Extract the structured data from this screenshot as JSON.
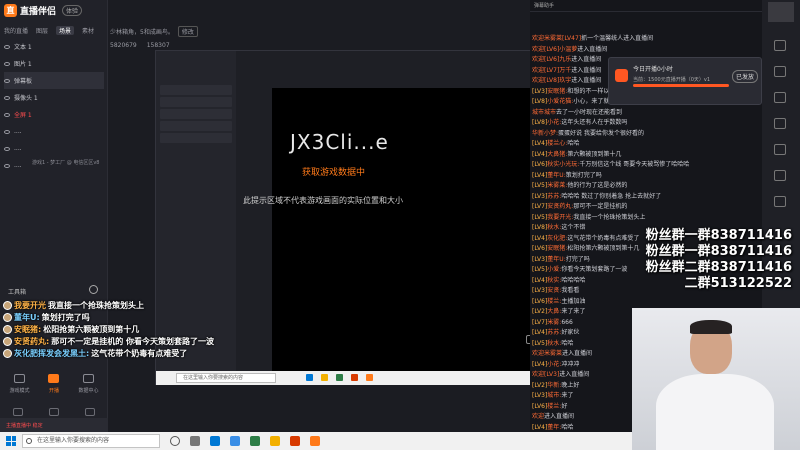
{
  "app": {
    "name": "直播伴侣",
    "tag": "体验",
    "tabs": [
      "我的直播",
      "图层",
      "场景",
      "素材"
    ]
  },
  "scenes": [
    {
      "label": "文本 1"
    },
    {
      "label": "图片 1"
    },
    {
      "label": "弹幕板"
    },
    {
      "label": "摄像头 1"
    },
    {
      "label": "全屏 1"
    },
    {
      "label": "...."
    },
    {
      "label": "...."
    },
    {
      "label": "...."
    }
  ],
  "left_note": "游戏1 - 梦工厂 @ 电信区区v8",
  "tools_label": "工具箱",
  "left_bottom": [
    {
      "label": "游戏模式"
    },
    {
      "label": "开播"
    },
    {
      "label": "数据中心"
    }
  ],
  "stream_info": {
    "title": "少林箱角，5和成画鸟。",
    "edit": "修改",
    "stats": [
      "5820679",
      "158307"
    ]
  },
  "game": {
    "title": "JX3Cli...e",
    "subtitle": "获取游戏数据中",
    "note": "此提示区域不代表游戏画面的实际位置和大小"
  },
  "danmaku": [
    {
      "name": "我要开光",
      "text": "我直接一个抢珠抢策划头上",
      "orange": true
    },
    {
      "name": "董年U:",
      "text": "策划打完了吗",
      "orange": false
    },
    {
      "name": "安眠猪:",
      "text": "松阳抢第六颗被顶到第十几",
      "orange": true
    },
    {
      "name": "安贤药丸:",
      "text": "那可不一定是挂机的 你看今天策划套路了一波",
      "orange": true
    },
    {
      "name": "灰化肥挥发会发黑土:",
      "text": "这气花带个奶毒有点难受了",
      "orange": false
    }
  ],
  "chat_head": "弹幕助手",
  "chat_lines": [
    {
      "tag": "",
      "user": "欢迎米雾莱[LV47]",
      "text": "抓一个温馨统人进入直播间"
    },
    {
      "tag": "",
      "user": "欢迎[LV6]小温萝",
      "text": "进入直播间"
    },
    {
      "tag": "",
      "user": "欢迎[LV6]九乐",
      "text": "进入直播间"
    },
    {
      "tag": "",
      "user": "欢迎[LV7]万千",
      "text": "进入直播间"
    },
    {
      "tag": "",
      "user": "欢迎[LV8]玖宇",
      "text": "进入直播间"
    },
    {
      "tag": "[LV3]",
      "user": "安眠猪:",
      "text": "和想的不一样以为还是没有"
    },
    {
      "tag": "[LV8]",
      "user": "小爱花猫:",
      "text": "小心，来了就想到的时候抢到力已经结束了 我经常看到的的时候的"
    },
    {
      "tag": "",
      "user": "城市城市",
      "text": "去了一小时现在还能看到"
    },
    {
      "tag": "[LV8]",
      "user": "小花:",
      "text": "这年头还有人在乎数数吗"
    },
    {
      "tag": "",
      "user": "华新小梦:",
      "text": "蛋蛋好说 我要给你发个很好看的"
    },
    {
      "tag": "[LV4]",
      "user": "楼兰心:",
      "text": "哈哈"
    },
    {
      "tag": "[LV4]",
      "user": "大鼻猪:",
      "text": "第六颗被顶到第十几"
    },
    {
      "tag": "[LV6]",
      "user": "秋实小光玩:",
      "text": "千万别信这个线 哥要今天被骂惨了哈哈哈"
    },
    {
      "tag": "[LV4]",
      "user": "董年U:",
      "text": "策划打完了吗"
    },
    {
      "tag": "[LV5]",
      "user": "米雾莱:",
      "text": "他的行为了这是必然的"
    },
    {
      "tag": "[LV3]",
      "user": "苏苏:",
      "text": "哈哈哈 数过了你别着急 抢上去就好了"
    },
    {
      "tag": "[LV7]",
      "user": "安贤药丸:",
      "text": "那可不一定是挂机的"
    },
    {
      "tag": "[LV5]",
      "user": "我要开光:",
      "text": "我直接一个抢珠抢策划头上"
    },
    {
      "tag": "[LV8]",
      "user": "秋水:",
      "text": "这个不错"
    },
    {
      "tag": "[LV4]",
      "user": "灰化肥:",
      "text": "这气花带个奶毒有点难受了"
    },
    {
      "tag": "[LV6]",
      "user": "安眠猪:",
      "text": "松阳抢第六颗被顶到第十几"
    },
    {
      "tag": "[LV3]",
      "user": "董年U:",
      "text": "打完了吗"
    },
    {
      "tag": "[LV5]",
      "user": "小爱:",
      "text": "你看今天策划套路了一波"
    },
    {
      "tag": "[LV4]",
      "user": "秋实:",
      "text": "哈哈哈哈"
    },
    {
      "tag": "[LV3]",
      "user": "安贤:",
      "text": "我看看"
    },
    {
      "tag": "[LV6]",
      "user": "楼兰:",
      "text": "主播加油"
    },
    {
      "tag": "[LV2]",
      "user": "大鼻:",
      "text": "来了来了"
    },
    {
      "tag": "[LV7]",
      "user": "米雾:",
      "text": "666"
    },
    {
      "tag": "[LV4]",
      "user": "苏苏:",
      "text": "好家伙"
    },
    {
      "tag": "[LV5]",
      "user": "秋水:",
      "text": "哈哈"
    },
    {
      "tag": "",
      "user": "欢迎米雾莱",
      "text": "进入直播间"
    },
    {
      "tag": "[LV4]",
      "user": "小花:",
      "text": "冲冲冲"
    },
    {
      "tag": "",
      "user": "欢迎[LV3]",
      "text": "进入直播间"
    },
    {
      "tag": "[LV2]",
      "user": "华新:",
      "text": "晚上好"
    },
    {
      "tag": "[LV3]",
      "user": "城市:",
      "text": "来了"
    },
    {
      "tag": "[LV6]",
      "user": "楼兰:",
      "text": "好"
    },
    {
      "tag": "",
      "user": "欢迎",
      "text": "进入直播间"
    },
    {
      "tag": "[LV4]",
      "user": "董年:",
      "text": "哈哈"
    },
    {
      "tag": "[LV5]",
      "user": "秋实:",
      "text": "对"
    }
  ],
  "popup": {
    "title": "今日开播0小时",
    "sub": "当前：1500元直播开播（0天）v1",
    "button": "已发放"
  },
  "fans": [
    {
      "text": "粉丝群一群838711416",
      "small": false
    },
    {
      "text": "粉丝群一群838711416",
      "small": false
    },
    {
      "text": "粉丝群二群838711416",
      "small": false
    },
    {
      "text": "二群513122522",
      "small": false
    }
  ],
  "taskbar": {
    "search_placeholder": "在这里输入你要搜索的内容"
  },
  "bottom_notice": "主播直播中 稳定",
  "colors": {
    "accent": "#ff7a1a",
    "chat_user": "#ff6b35",
    "taskbar": "#f1f1f1"
  }
}
